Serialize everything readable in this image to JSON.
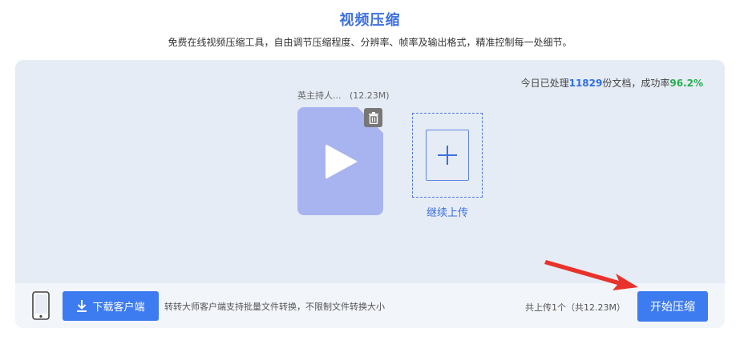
{
  "header": {
    "title": "视频压缩",
    "subtitle": "免费在线视频压缩工具，自由调节压缩程度、分辨率、帧率及输出格式，精准控制每一处细节。"
  },
  "stats": {
    "prefix": "今日已处理",
    "processed": "11829",
    "middle": "份文档，成功率",
    "success_rate": "96.2%"
  },
  "file": {
    "name": "英主持人...",
    "size": "(12.23M)",
    "icon": "video-play-icon"
  },
  "add": {
    "label": "继续上传",
    "icon": "plus-icon"
  },
  "bottom": {
    "download_label": "下载客户端",
    "download_icon": "download-icon",
    "client_hint": "转转大师客户端支持批量文件转换，不限制文件转换大小",
    "upload_count": "共上传1个（共12.23M）",
    "start_label": "开始压缩"
  },
  "colors": {
    "accent": "#3d7bf0",
    "title": "#3d6fe0",
    "success": "#22b04c",
    "annotation": "#e8322b"
  }
}
